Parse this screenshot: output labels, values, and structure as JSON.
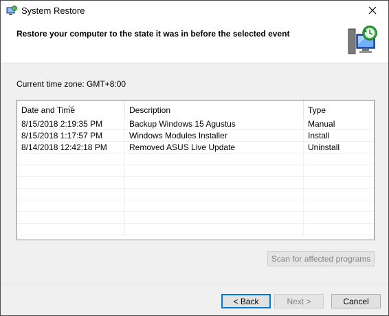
{
  "window": {
    "title": "System Restore"
  },
  "header": {
    "heading": "Restore your computer to the state it was in before the selected event"
  },
  "timezone": {
    "label": "Current time zone: GMT+8:00"
  },
  "list": {
    "columns": [
      "Date and Time",
      "Description",
      "Type"
    ],
    "sorted_column": "Date and Time",
    "rows": [
      [
        "8/15/2018 2:19:35 PM",
        "Backup Windows 15 Agustus",
        "Manual"
      ],
      [
        "8/15/2018 1:17:57 PM",
        "Windows Modules Installer",
        "Install"
      ],
      [
        "8/14/2018 12:42:18 PM",
        "Removed ASUS Live Update",
        "Uninstall"
      ]
    ]
  },
  "buttons": {
    "scan": "Scan for affected programs",
    "back": "< Back",
    "next": "Next >",
    "cancel": "Cancel"
  },
  "icons": {
    "app": "system-restore-icon",
    "header": "restore-computer-icon",
    "close": "close-icon",
    "sort": "sort-down-icon"
  }
}
